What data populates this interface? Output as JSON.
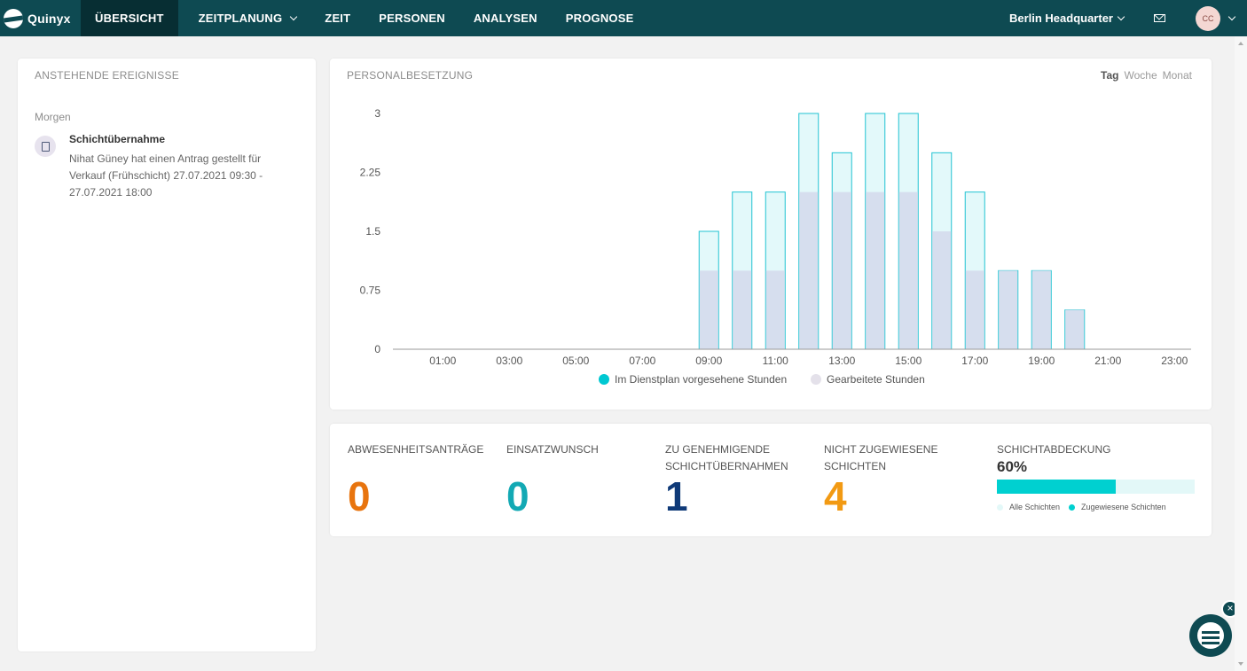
{
  "nav": {
    "logo": "Quinyx",
    "tabs": [
      {
        "label": "ÜBERSICHT",
        "active": true
      },
      {
        "label": "ZEITPLANUNG",
        "dropdown": true
      },
      {
        "label": "ZEIT"
      },
      {
        "label": "PERSONEN"
      },
      {
        "label": "ANALYSEN"
      },
      {
        "label": "PROGNOSE"
      }
    ],
    "location": "Berlin Headquarter",
    "avatar_initials": "CC"
  },
  "events": {
    "title": "ANSTEHENDE EREIGNISSE",
    "day": "Morgen",
    "item": {
      "title": "Schichtübernahme",
      "description": "Nihat Güney hat einen Antrag gestellt für Verkauf (Frühschicht) 27.07.2021 09:30 - 27.07.2021 18:00"
    }
  },
  "staffing": {
    "title": "PERSONALBESETZUNG",
    "periods": [
      "Tag",
      "Woche",
      "Monat"
    ],
    "active_period": "Tag"
  },
  "chart_data": {
    "type": "bar",
    "categories": [
      "00:00",
      "01:00",
      "02:00",
      "03:00",
      "04:00",
      "05:00",
      "06:00",
      "07:00",
      "08:00",
      "09:00",
      "10:00",
      "11:00",
      "12:00",
      "13:00",
      "14:00",
      "15:00",
      "16:00",
      "17:00",
      "18:00",
      "19:00",
      "20:00",
      "21:00",
      "22:00",
      "23:00"
    ],
    "xticks": [
      "01:00",
      "03:00",
      "05:00",
      "07:00",
      "09:00",
      "11:00",
      "13:00",
      "15:00",
      "17:00",
      "19:00",
      "21:00",
      "23:00"
    ],
    "yticks": [
      "3",
      "2.25",
      "1.5",
      "0.75",
      "0"
    ],
    "ylim": [
      0,
      3
    ],
    "series": [
      {
        "name": "Im Dienstplan vorgesehene Stunden",
        "color": "#e3f9fa",
        "border": "#21c3d2",
        "values": [
          0,
          0,
          0,
          0,
          0,
          0,
          0,
          0,
          0,
          1.5,
          2,
          2,
          3,
          2.5,
          3,
          3,
          2.5,
          2,
          1,
          1,
          0.5,
          0,
          0,
          0
        ]
      },
      {
        "name": "Gearbeitete Stunden",
        "color": "#d6deee",
        "values": [
          0,
          0,
          0,
          0,
          0,
          0,
          0,
          0,
          0,
          1,
          1,
          1,
          2,
          2,
          2,
          2,
          1.5,
          1,
          1,
          1,
          0.5,
          0,
          0,
          0
        ]
      }
    ],
    "legend": [
      {
        "label": "Im Dienstplan vorgesehene Stunden",
        "color": "#00c8d2"
      },
      {
        "label": "Gearbeitete Stunden",
        "color": "#e4e1ea"
      }
    ]
  },
  "stats": [
    {
      "label": "ABWESENHEITSANTRÄGE",
      "value": "0",
      "color": "#e8740e"
    },
    {
      "label": "EINSATZWUNSCH",
      "value": "0",
      "color": "#13a9b4"
    },
    {
      "label": "ZU GENEHMIGENDE SCHICHTÜBERNAHMEN",
      "value": "1",
      "color": "#0f3a78"
    },
    {
      "label": "NICHT ZUGEWIESENE SCHICHTEN",
      "value": "4",
      "color": "#f29a13"
    }
  ],
  "coverage": {
    "title": "SCHICHTABDECKUNG",
    "percent_label": "60%",
    "fraction": 0.6,
    "legend": [
      {
        "label": "Alle Schichten",
        "color": "#e3f8f8"
      },
      {
        "label": "Zugewiesene Schichten",
        "color": "#00d0d0"
      }
    ]
  }
}
